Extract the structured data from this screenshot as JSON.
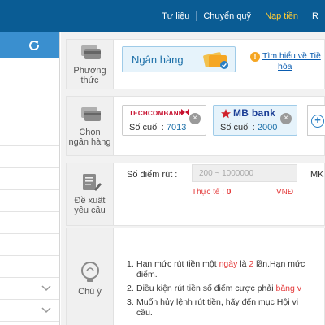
{
  "topnav": {
    "items": [
      {
        "label": "Tư liệu"
      },
      {
        "label": "Chuyển quỹ"
      },
      {
        "label": "Nạp tiền"
      },
      {
        "label": "R"
      }
    ]
  },
  "sidebar": {
    "refresh_icon": "refresh-icon",
    "chevron_icon": "chevron-down-icon"
  },
  "method": {
    "label_line1": "Phương",
    "label_line2": "thức",
    "option_label": "Ngân hàng",
    "learn_link_line1": "Tìm hiểu về Tiề",
    "learn_link_line2": "hóa",
    "warn_glyph": "!"
  },
  "bank_select": {
    "label_line1": "Chọn",
    "label_line2": "ngân hàng",
    "suffix_label": "Số cuối :",
    "cards": [
      {
        "logo": "TECHCOMBANK",
        "suffix": "7013"
      },
      {
        "logo": "MB bank",
        "suffix": "2000"
      }
    ],
    "add_label": "+"
  },
  "request": {
    "label_line1": "Đề xuất",
    "label_line2": "yêu cầu",
    "points_label": "Số điểm rút :",
    "points_placeholder": "200 ~ 1000000",
    "mk_label": "MK b",
    "actual_label": "Thực tế :",
    "actual_value": "0",
    "currency": "VNĐ"
  },
  "notes": {
    "label": "Chú ý",
    "items": [
      {
        "num": "1.",
        "pre": "Hạn mức rút tiền một ",
        "hl1": "ngày",
        "mid": " là ",
        "hl2": "2",
        "post": " lần.Hạn mức",
        "line2": "điểm."
      },
      {
        "num": "2.",
        "pre": "Điều kiện rút tiền số điểm cược phải ",
        "hl1": "bằng v"
      },
      {
        "num": "3.",
        "pre": "Muốn hủy lệnh rút tiền, hãy đến mục Hội vi",
        "line2": "cầu."
      }
    ]
  },
  "colors": {
    "topbar": "#0a5c94",
    "active_nav": "#ffcc33",
    "sidebar_header": "#3a8fcf",
    "highlight_red": "#e43b3b",
    "link_blue": "#0a5cb0"
  }
}
